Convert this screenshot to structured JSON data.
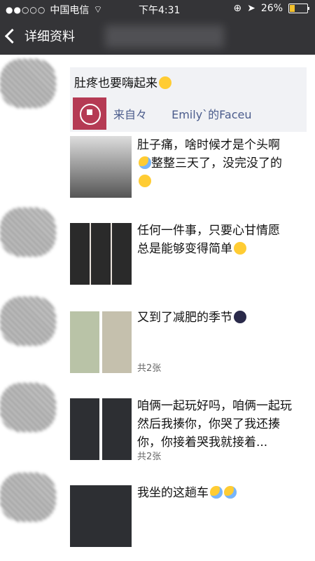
{
  "status": {
    "carrier": "中国电信",
    "time": "下午4:31",
    "battery": "26%"
  },
  "nav": {
    "back_label": "详细资料"
  },
  "posts": [
    {
      "text": "肚疼也要嗨起来",
      "share_source": "来自々",
      "share_name": "Emily`的Faceu"
    },
    {
      "text": "肚子痛，啥时候才是个头啊",
      "text2": "整整三天了，没完没了的"
    },
    {
      "text": "任何一件事，只要心甘情愿",
      "text2": "总是能够变得简单"
    },
    {
      "text": "又到了减肥的季节",
      "count": "共2张"
    },
    {
      "text": "咱俩一起玩好吗，咱俩一起玩然后我揍你，你哭了我还揍你，你接着哭我就接着...",
      "count": "共2张"
    },
    {
      "text": "我坐的这趟车"
    }
  ]
}
